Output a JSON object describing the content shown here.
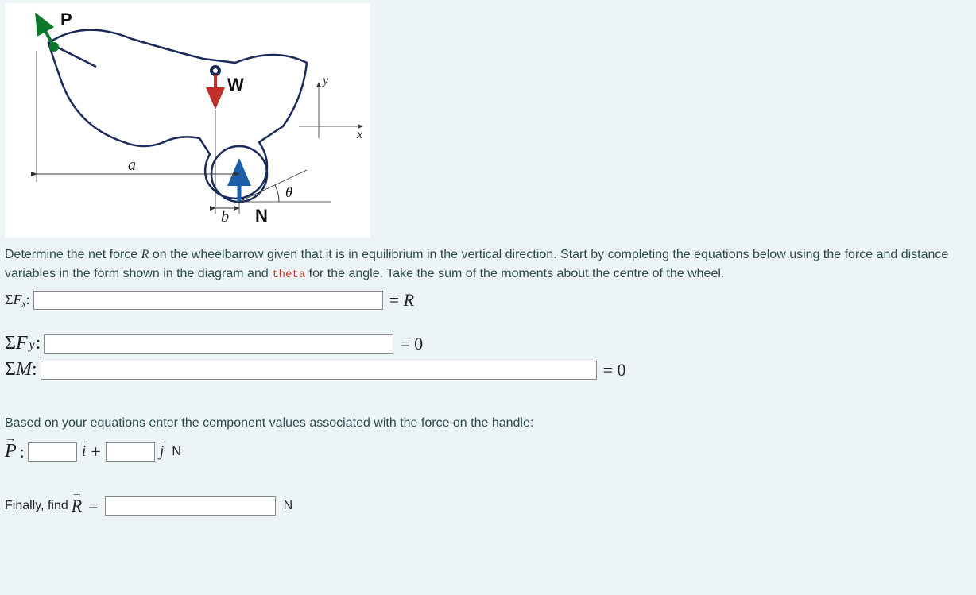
{
  "diagram": {
    "labels": {
      "P": "P",
      "W": "W",
      "N": "N",
      "a": "a",
      "b": "b",
      "theta": "θ",
      "x": "x",
      "y": "y"
    }
  },
  "text": {
    "prompt_part1": "Determine the net force ",
    "prompt_Rvar": "R",
    "prompt_part2": " on the wheelbarrow given that it is in equilibrium in the vertical direction.  Start by completing the equations below using the force and distance variables in the form shown in the diagram and ",
    "theta_var": "theta",
    "prompt_part3": " for the angle.  Take the sum of the moments about the centre of the wheel.",
    "based_on": "Based on your equations enter the component values associated with the force on the handle:",
    "finally": "Finally, find "
  },
  "equations": {
    "sigma": "Σ",
    "Fx_label_F": "F",
    "Fx_label_sub": "x",
    "Fx_input": "",
    "Fx_rhs_eq": "=",
    "Fx_rhs_val": "R",
    "Fy_label_F": "F",
    "Fy_label_sub": "y",
    "Fy_input": "",
    "Fy_rhs": "= 0",
    "M_label": "M",
    "M_input": "",
    "M_rhs": "= 0",
    "Pvec": "P",
    "colon": ":",
    "P_i_input": "",
    "i_hat": "i",
    "plus": "+",
    "P_j_input": "",
    "j_hat": "j",
    "unit_N": "N",
    "Rvec": "R",
    "R_eq": "=",
    "R_input": ""
  }
}
